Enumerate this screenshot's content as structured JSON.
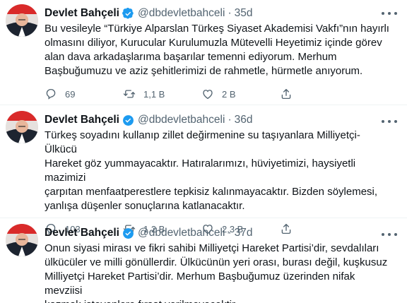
{
  "user": {
    "name": "Devlet Bahçeli",
    "handle": "@dbdevletbahceli",
    "verified": true,
    "avatar_icon": "profile-photo"
  },
  "separator": "·",
  "colors": {
    "text": "#0f1419",
    "secondary": "#536471",
    "verified": "#1d9bf0",
    "border": "#eff3f4"
  },
  "tweets": [
    {
      "time": "35d",
      "text": "Bu vesileyle “Türkiye Alparslan Türkeş Siyaset Akademisi Vakfı”nın hayırlı\nolmasını diliyor, Kurucular Kurulumuzla Mütevelli Heyetimiz içinde görev\nalan dava arkadaşlarıma başarılar temenni ediyorum. Merhum\nBaşbuğumuzu ve aziz şehitlerimizi de rahmetle, hürmetle anıyorum.",
      "replies": "69",
      "retweets": "1,1 B",
      "likes": "2 B"
    },
    {
      "time": "36d",
      "text": "Türkeş soyadını kullanıp zillet değirmenine su taşıyanlara Milliyetçi-Ülkücü\nHareket göz yummayacaktır. Hatıralarımızı, hüviyetimizi, haysiyetli mazimizi\nçarpıtan menfaatperestlere tepkisiz kalınmayacaktır. Bizden söylemesi,\nyanlışa düşenler sonuçlarına katlanacaktır.",
      "replies": "103",
      "retweets": "1,2 B",
      "likes": "2,3 B"
    },
    {
      "time": "37d",
      "text": "Onun siyasi mirası ve fikri sahibi Milliyetçi Hareket Partisi’dir, sevdalıları\nülkücüler ve milli gönüllerdir. Ülkücünün yeri orası, burası değil, kuşkusuz\nMilliyetçi Hareket Partisi’dir. Merhum Başbuğumuz üzerinden nifak mevziisi\nkazmak isteyenlere fırsat verilmeyecektir."
    }
  ]
}
